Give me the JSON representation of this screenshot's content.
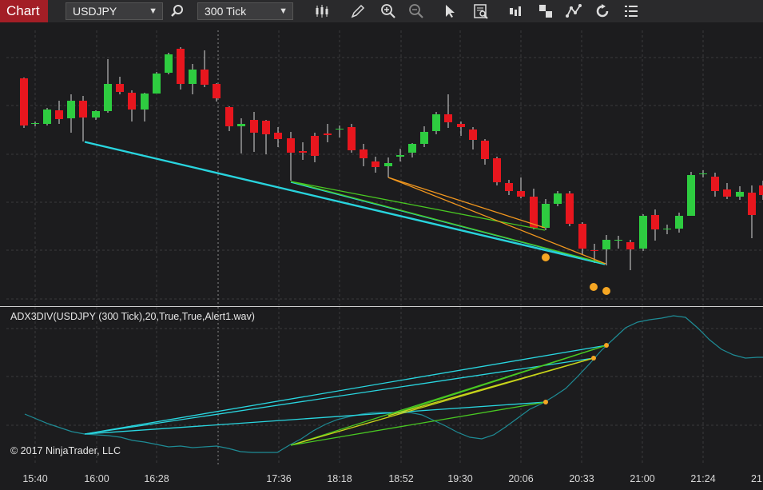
{
  "toolbar": {
    "tab_label": "Chart",
    "instrument": "USDJPY",
    "interval": "300 Tick",
    "icons": [
      "bar-style-icon",
      "draw-pencil-icon",
      "zoom-in-icon",
      "zoom-out-icon",
      "pointer-icon",
      "data-box-icon",
      "chart-trader-icon",
      "templates-icon",
      "drawing-objects-icon",
      "reload-icon",
      "properties-icon"
    ]
  },
  "indicator": {
    "label": "ADX3DIV(USDJPY (300 Tick),20,True,True,Alert1.wav)"
  },
  "copyright": "© 2017 NinjaTrader, LLC",
  "time_axis": {
    "labels": [
      "15:40",
      "16:00",
      "16:28",
      "17:36",
      "18:18",
      "18:52",
      "19:30",
      "20:06",
      "20:33",
      "21:00",
      "21:24",
      "21"
    ]
  },
  "colors": {
    "background": "#1c1c1e",
    "up_candle": "#2ecc40",
    "down_candle": "#e8161e",
    "cyan_line": "#29d6e0",
    "green_line": "#49c822",
    "yellow_line": "#c8d41a",
    "orange_line": "#f0961e",
    "dot": "#f5a623",
    "adx_line": "#1e8c96"
  }
}
